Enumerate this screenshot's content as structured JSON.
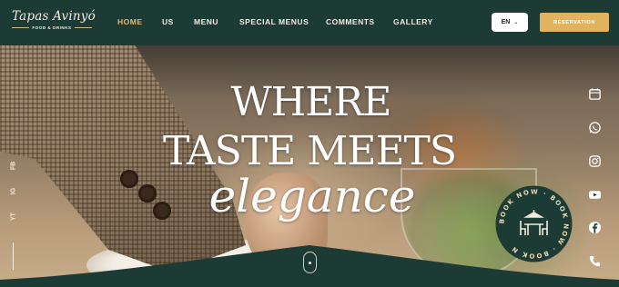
{
  "brand": {
    "name": "Tapas Avinyó",
    "subtitle": "FOOD & DRINKS"
  },
  "nav": [
    {
      "label": "HOME",
      "active": true
    },
    {
      "label": "US",
      "active": false
    },
    {
      "label": "MENU",
      "active": false
    },
    {
      "label": "SPECIAL MENUS",
      "active": false
    },
    {
      "label": "COMMENTS",
      "active": false
    },
    {
      "label": "GALLERY",
      "active": false
    }
  ],
  "language": {
    "label": "EN",
    "icon": "chevron-down-icon"
  },
  "reservation_label": "RESERVATION",
  "hero": {
    "line1": "WHERE",
    "line2": "TASTE MEETS",
    "line3": "elegance"
  },
  "left_social": [
    "FB",
    "IG",
    "YT"
  ],
  "right_icons": [
    "calendar-icon",
    "whatsapp-icon",
    "instagram-icon",
    "youtube-icon",
    "facebook-icon",
    "phone-icon"
  ],
  "badge": {
    "text": "BOOK NOW · BOOK NOW · BOOK N",
    "icon": "dining-table-icon"
  },
  "colors": {
    "primary": "#1d3b35",
    "accent": "#e2b25e",
    "active_nav": "#e8b86b",
    "cream": "#f4ecdc"
  }
}
